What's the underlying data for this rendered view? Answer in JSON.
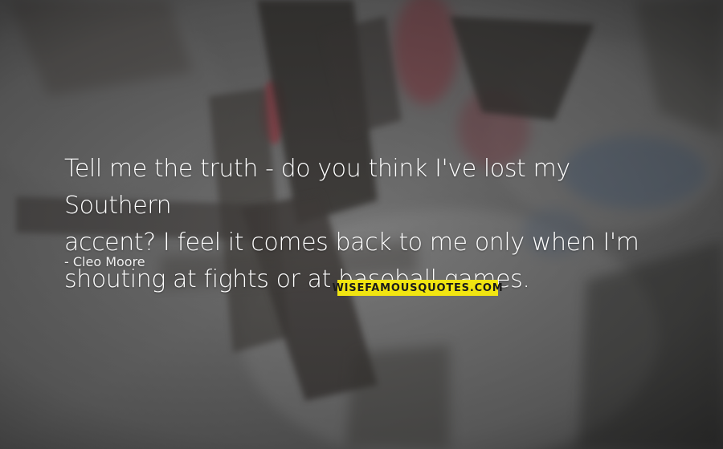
{
  "quote": {
    "line1": "Tell me the truth - do you think I've lost my Southern",
    "line2": "accent? I feel it comes back to me only when I'm",
    "line3": "shouting at fights or at baseball games."
  },
  "author": "- Cleo Moore",
  "logo": {
    "text": "WISEFAMOUSQUOTES.COM",
    "color": "#f1e511"
  },
  "colors": {
    "background": "#6f6f6f",
    "text": "#ffffff",
    "accent_red": "#b0323f",
    "accent_blue": "#4f6f97"
  }
}
